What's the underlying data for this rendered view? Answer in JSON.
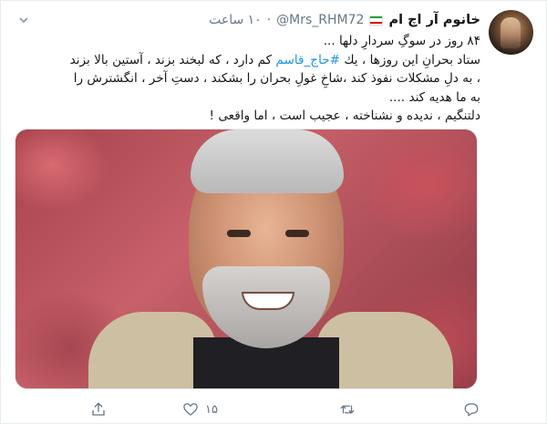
{
  "user": {
    "display_name": "خانوم آر اچ ام",
    "handle": "@Mrs_RHM72",
    "separator": "·",
    "time": "۱۰ ساعت",
    "flag_icon": "iran-flag-icon"
  },
  "tweet": {
    "lines": [
      "۸۴ روز در سوگِ سردارِ دلها ...",
      "ستاد بحرانِ این روزها ، یك",
      "کم دارد ، که لبخند بزند ، آستین بالا بزند",
      "، به دلِ مشکلات نفوذ کند ،شاخِ غولِ بحران را بشکند ، دستِ آخر ، انگشترش را",
      "به ما هدیه کند ....",
      "دلتنگیم ، ندیده و نشناخته ، عجیب است ، اما واقعی !"
    ],
    "hashtag": "#حاج_قاسم"
  },
  "media": {
    "alt": "photo"
  },
  "actions": {
    "reply": {
      "icon": "reply-icon",
      "count": ""
    },
    "retweet": {
      "icon": "retweet-icon",
      "count": ""
    },
    "like": {
      "icon": "heart-icon",
      "count": "۱۵"
    },
    "share": {
      "icon": "share-icon",
      "count": ""
    }
  },
  "colors": {
    "link": "#1b95e0",
    "muted": "#657786",
    "text": "#14171a"
  }
}
